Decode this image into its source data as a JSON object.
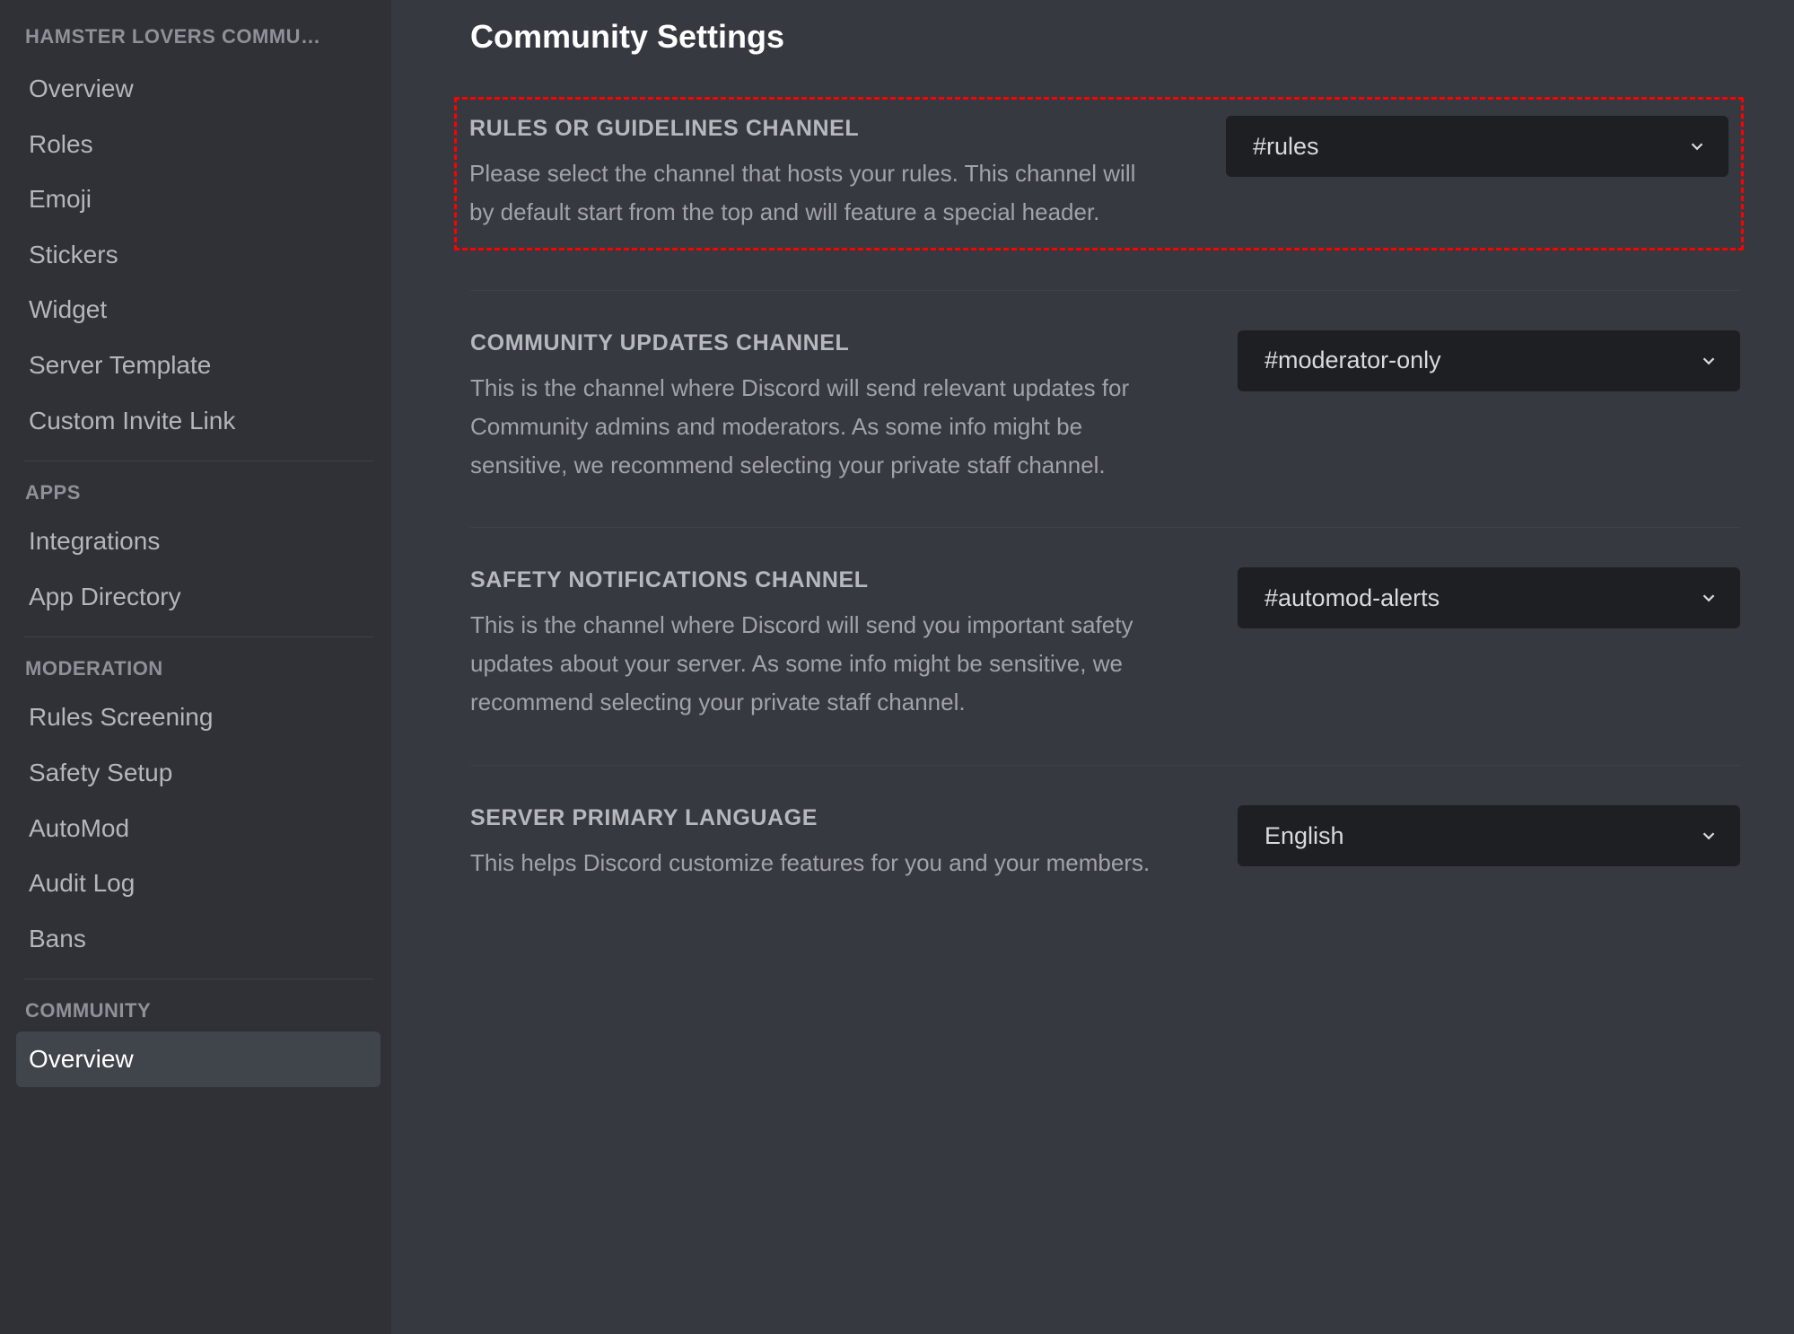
{
  "sidebar": {
    "server_name": "HAMSTER LOVERS COMMU…",
    "groups": [
      {
        "label": null,
        "items": [
          {
            "label": "Overview",
            "active": false
          },
          {
            "label": "Roles",
            "active": false
          },
          {
            "label": "Emoji",
            "active": false
          },
          {
            "label": "Stickers",
            "active": false
          },
          {
            "label": "Widget",
            "active": false
          },
          {
            "label": "Server Template",
            "active": false
          },
          {
            "label": "Custom Invite Link",
            "active": false
          }
        ]
      },
      {
        "label": "APPS",
        "items": [
          {
            "label": "Integrations",
            "active": false
          },
          {
            "label": "App Directory",
            "active": false
          }
        ]
      },
      {
        "label": "MODERATION",
        "items": [
          {
            "label": "Rules Screening",
            "active": false
          },
          {
            "label": "Safety Setup",
            "active": false
          },
          {
            "label": "AutoMod",
            "active": false
          },
          {
            "label": "Audit Log",
            "active": false
          },
          {
            "label": "Bans",
            "active": false
          }
        ]
      },
      {
        "label": "COMMUNITY",
        "items": [
          {
            "label": "Overview",
            "active": true
          }
        ]
      }
    ]
  },
  "main": {
    "title": "Community Settings",
    "settings": [
      {
        "title": "RULES OR GUIDELINES CHANNEL",
        "desc": "Please select the channel that hosts your rules. This channel will by default start from the top and will feature a special header.",
        "value": "#rules",
        "highlighted": true
      },
      {
        "title": "COMMUNITY UPDATES CHANNEL",
        "desc": "This is the channel where Discord will send relevant updates for Community admins and moderators. As some info might be sensitive, we recommend selecting your private staff channel.",
        "value": "#moderator-only",
        "highlighted": false
      },
      {
        "title": "SAFETY NOTIFICATIONS CHANNEL",
        "desc": "This is the channel where Discord will send you important safety updates about your server. As some info might be sensitive, we recommend selecting your private staff channel.",
        "value": "#automod-alerts",
        "highlighted": false
      },
      {
        "title": "SERVER PRIMARY LANGUAGE",
        "desc": "This helps Discord customize features for you and your members.",
        "value": "English",
        "highlighted": false
      }
    ]
  }
}
